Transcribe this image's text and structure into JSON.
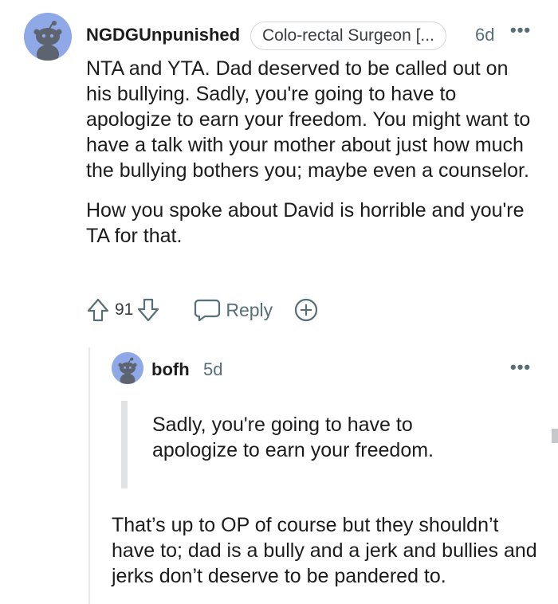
{
  "comment": {
    "username": "NGDGUnpunished",
    "flair": "Colo-rectal Surgeon [...",
    "age": "6d",
    "more_icon": "ellipsis-icon",
    "paragraphs": [
      "NTA and YTA. Dad deserved to be called out on his bullying. Sadly, you're going to have to apologize to earn your freedom. You might want to have a talk with your mother about just how much the bullying bothers you; maybe even a counselor.",
      "How you spoke about David is horrible and you're TA for that."
    ],
    "votes": "91",
    "reply_label": "Reply",
    "avatar_color": "#8fa8e8"
  },
  "reply": {
    "username": "bofh",
    "age": "5d",
    "more_icon": "ellipsis-icon",
    "quote": "Sadly, you're going to have to apologize to earn your freedom.",
    "text": "That’s up to OP of course but they shouldn’t have to; dad is a bully and a jerk and bullies and jerks don’t deserve to be pandered to."
  }
}
